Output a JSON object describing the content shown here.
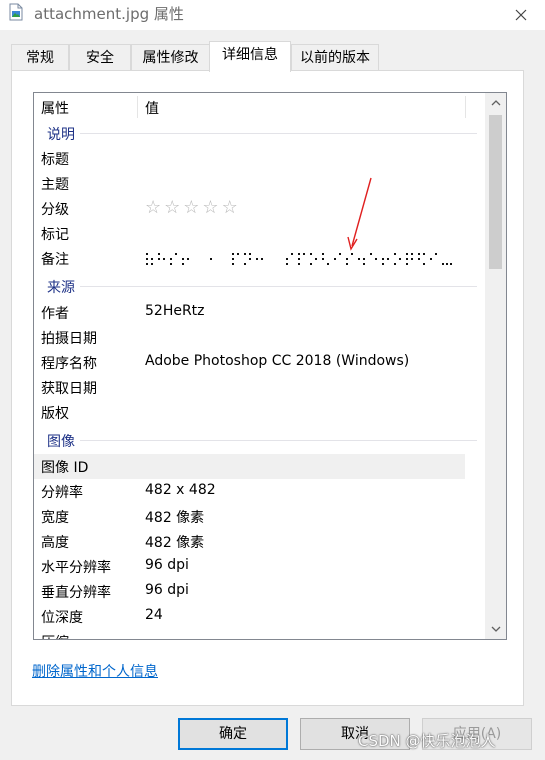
{
  "window": {
    "title": "attachment.jpg 属性",
    "icon": "image-file-icon",
    "close_icon": "close-icon"
  },
  "tabs": [
    {
      "label": "常规",
      "active": false
    },
    {
      "label": "安全",
      "active": false
    },
    {
      "label": "属性修改",
      "active": false
    },
    {
      "label": "详细信息",
      "active": true
    },
    {
      "label": "以前的版本",
      "active": false
    }
  ],
  "columns": {
    "property": "属性",
    "value": "值"
  },
  "groups": {
    "description": "说明",
    "origin": "来源",
    "image": "图像"
  },
  "description_rows": {
    "title": {
      "name": "标题",
      "value": ""
    },
    "subject": {
      "name": "主题",
      "value": ""
    },
    "rating": {
      "name": "分级",
      "stars_total": 5,
      "stars_filled": 0
    },
    "tags": {
      "name": "标记",
      "value": ""
    },
    "comments": {
      "name": "备注",
      "value_encoding": "braille-dot-pattern"
    }
  },
  "origin_rows": {
    "author": {
      "name": "作者",
      "value": "52HeRtz"
    },
    "date_taken": {
      "name": "拍摄日期",
      "value": ""
    },
    "program": {
      "name": "程序名称",
      "value": "Adobe Photoshop CC 2018 (Windows)"
    },
    "date_acquired": {
      "name": "获取日期",
      "value": ""
    },
    "copyright": {
      "name": "版权",
      "value": ""
    }
  },
  "image_rows": {
    "image_id": {
      "name": "图像 ID",
      "value": ""
    },
    "dimensions": {
      "name": "分辨率",
      "value": "482 x 482"
    },
    "width": {
      "name": "宽度",
      "value": "482 像素"
    },
    "height": {
      "name": "高度",
      "value": "482 像素"
    },
    "h_res": {
      "name": "水平分辨率",
      "value": "96 dpi"
    },
    "v_res": {
      "name": "垂直分辨率",
      "value": "96 dpi"
    },
    "bit_depth": {
      "name": "位深度",
      "value": "24"
    },
    "compression": {
      "name": "压缩",
      "value": ""
    }
  },
  "remove_link": "删除属性和个人信息",
  "buttons": {
    "ok": "确定",
    "cancel": "取消",
    "apply": "应用(A)"
  },
  "watermark": "CSDN @快乐泡泡人",
  "colors": {
    "group_header": "#1e3287",
    "link": "#0066cc",
    "annotation_arrow": "#e02020",
    "default_button_border": "#0078d7"
  }
}
